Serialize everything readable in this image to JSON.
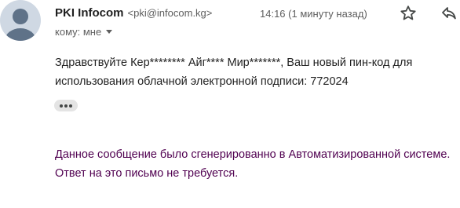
{
  "sender": {
    "name": "PKI Infocom",
    "email": "<pki@infocom.kg>"
  },
  "timestamp": "14:16 (1 минуту назад)",
  "recipient": {
    "label": "кому: мне"
  },
  "message": {
    "body": "Здравствуйте Кер******** Айг**** Мир*******, Ваш новый пин-код для использования облачной электронной подписи: 772024",
    "footer_line1": "Данное сообщение было сгенерированно в Автоматизированной системе.",
    "footer_line2": "Ответ на это письмо не требуется."
  },
  "icons": {
    "avatar": "person-avatar-icon",
    "star": "star-outline-icon",
    "reply": "reply-icon",
    "caret": "chevron-down-icon",
    "trimmed": "more-horizontal-icon"
  },
  "colors": {
    "footer_text": "#500050",
    "avatar_bg": "#cfd8e3",
    "avatar_fg": "#5f7288"
  }
}
